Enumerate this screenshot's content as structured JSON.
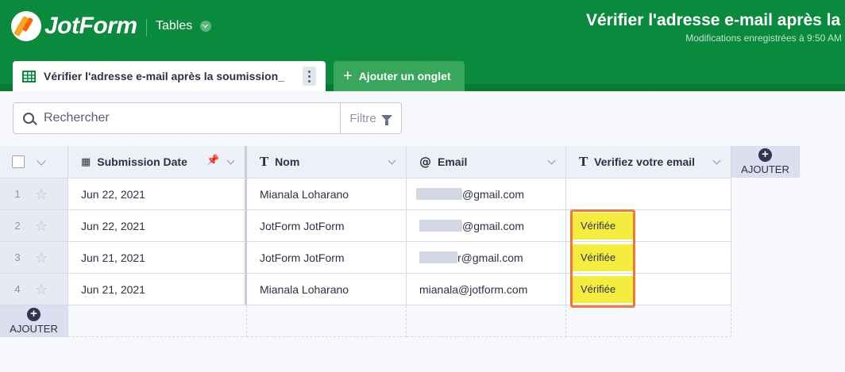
{
  "header": {
    "logo_text": "JotForm",
    "tables_label": "Tables",
    "doc_title": "Vérifier l'adresse e-mail après la soumission",
    "saved_status": "Modifications enregistrées à 9:50 AM"
  },
  "tabs": {
    "active_label": "Vérifier l'adresse e-mail après la soumission_",
    "add_label": "Ajouter un onglet"
  },
  "toolbar": {
    "search_placeholder": "Rechercher",
    "filter_label": "Filtre"
  },
  "columns": [
    {
      "label": "Submission Date",
      "icon": "calendar-icon"
    },
    {
      "label": "Nom",
      "icon": "text-icon"
    },
    {
      "label": "Email",
      "icon": "at-icon"
    },
    {
      "label": "Verifiez votre email",
      "icon": "text-icon"
    }
  ],
  "add_column_label": "AJOUTER",
  "add_row_label": "AJOUTER",
  "rows": [
    {
      "num": "1",
      "date": "Jun 22, 2021",
      "name": "Mianala Loharano",
      "email": "@gmail.com",
      "verified": ""
    },
    {
      "num": "2",
      "date": "Jun 22, 2021",
      "name": "JotForm JotForm",
      "email": "@gmail.com",
      "verified": "Vérifiée"
    },
    {
      "num": "3",
      "date": "Jun 21, 2021",
      "name": "JotForm JotForm",
      "email": "r@gmail.com",
      "verified": "Vérifiée"
    },
    {
      "num": "4",
      "date": "Jun 21, 2021",
      "name": "Mianala Loharano",
      "email": "mianala@jotform.com",
      "verified": "Vérifiée"
    }
  ],
  "colors": {
    "brand_green": "#0a8a3c",
    "verified_badge": "#f4ec3f",
    "highlight_border": "#f07a3a"
  }
}
